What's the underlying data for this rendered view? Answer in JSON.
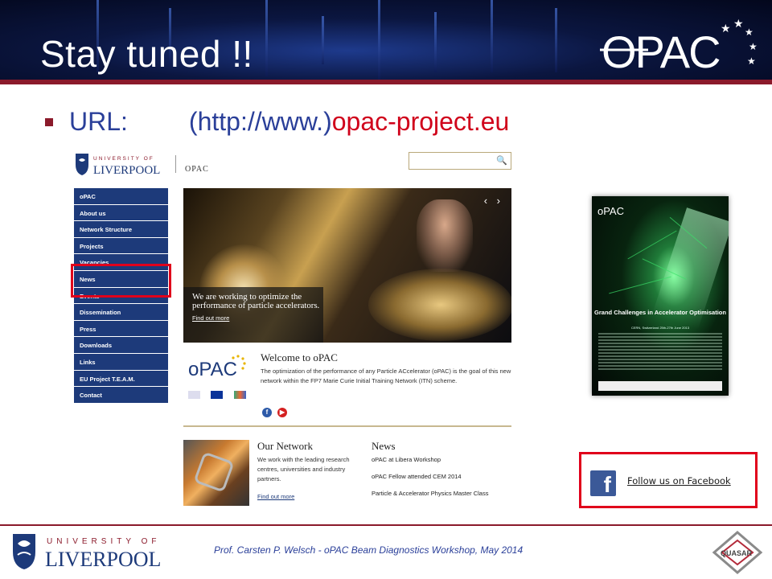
{
  "slide": {
    "title": "Stay tuned !!",
    "bullet": {
      "label": "URL:",
      "url_prefix": "(http://www.)",
      "url_domain": "opac-project.eu"
    },
    "footer": {
      "credit": "Prof. Carsten P. Welsch - oPAC Beam Diagnostics Workshop, May 2014",
      "university_line1": "UNIVERSITY OF",
      "university_line2": "LIVERPOOL",
      "quasar_label": "QUASAR"
    },
    "logo_text": "OPAC"
  },
  "website": {
    "university_line1": "UNIVERSITY OF",
    "university_line2": "LIVERPOOL",
    "header_label": "OPAC",
    "search_placeholder": "",
    "nav": [
      "oPAC",
      "About us",
      "Network Structure",
      "Projects",
      "Vacancies",
      "News",
      "Events",
      "Dissemination",
      "Press",
      "Downloads",
      "Links",
      "EU Project T.E.A.M.",
      "Contact"
    ],
    "hero": {
      "caption": "We are working to optimize the performance of particle accelerators.",
      "link": "Find out more",
      "arrows": "‹ ›"
    },
    "welcome": {
      "logo_text": "oPAC",
      "title": "Welcome to oPAC",
      "text": "The optimization of the performance of any Particle ACcelerator (oPAC) is the goal of this new network within the FP7 Marie Curie Initial Training Network (ITN) scheme."
    },
    "network": {
      "title": "Our Network",
      "text": "We work with the leading research centres, universities and industry partners.",
      "link": "Find out more"
    },
    "news": {
      "title": "News",
      "items": [
        "oPAC at Libera Workshop",
        "oPAC Fellow attended CEM 2014",
        "Particle & Accelerator Physics Master Class"
      ]
    }
  },
  "poster": {
    "logo_text": "oPAC",
    "heading": "Grand Challenges in Accelerator Optimisation",
    "subheading": "CERN, Switzerland 25th-27th June 2013"
  },
  "facebook": {
    "icon": "facebook-icon",
    "text": "Follow us on Facebook"
  },
  "colors": {
    "accent_red": "#e0001b",
    "url_red": "#d0021b",
    "title_blue": "#2a3f99",
    "nav_blue": "#1d3a7a",
    "brand_maroon": "#8b1a2b"
  }
}
